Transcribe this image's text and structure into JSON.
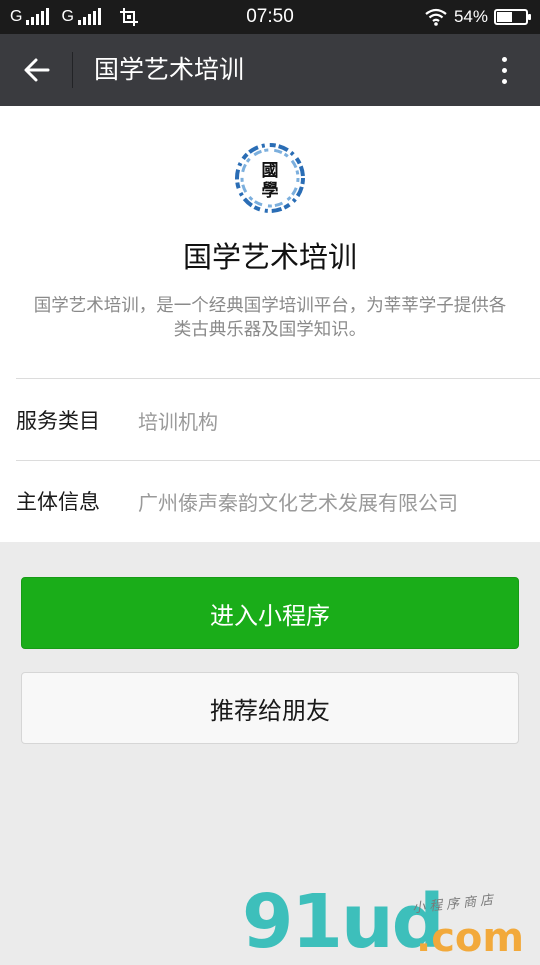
{
  "status_bar": {
    "carrier_1": "G",
    "carrier_2": "G",
    "time": "07:50",
    "battery_percent": "54%",
    "battery_level": 0.54,
    "icons": [
      "signal-icon",
      "screenshot-crop-icon",
      "wifi-icon",
      "battery-icon"
    ]
  },
  "nav": {
    "title": "国学艺术培训",
    "back_icon": "arrow-left-icon",
    "more_icon": "more-vertical-icon"
  },
  "app": {
    "logo_text_top": "國",
    "logo_text_bottom": "學",
    "name": "国学艺术培训",
    "description": "国学艺术培训，是一个经典国学培训平台，为莘莘学子提供各类古典乐器及国学知识。"
  },
  "info": {
    "service_label": "服务类目",
    "service_value": "培训机构",
    "entity_label": "主体信息",
    "entity_value": "广州傣声秦韵文化艺术发展有限公司"
  },
  "buttons": {
    "enter_label": "进入小程序",
    "share_label": "推荐给朋友"
  },
  "watermark": {
    "main": "91ud",
    "com": ".com",
    "sub": "小程序商店"
  },
  "colors": {
    "primary_green": "#1aad19",
    "nav_bg": "#3a3b3f",
    "status_bg": "#1b1b1b",
    "page_bg": "#ebebeb",
    "watermark_teal": "#3dbfbb",
    "watermark_orange": "#f2a93b"
  }
}
